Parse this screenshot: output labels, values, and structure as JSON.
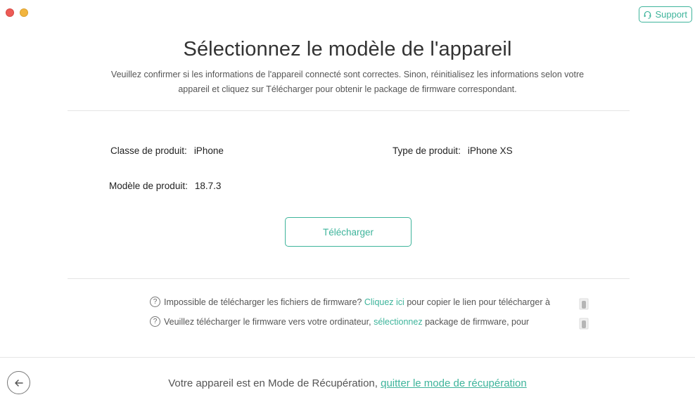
{
  "window": {
    "controls": [
      "close",
      "minimize"
    ]
  },
  "support": {
    "label": "Support",
    "icon": "headset-icon"
  },
  "header": {
    "title": "Sélectionnez le modèle de l'appareil",
    "subtitle_line1": "Veuillez confirmer si les informations de l'appareil connecté sont correctes. Sinon, réinitialisez les informations selon votre",
    "subtitle_line2": "appareil et cliquez sur Télécharger pour obtenir le package de firmware correspondant."
  },
  "device_info": {
    "product_class_label": "Classe de produit:",
    "product_class_value": "iPhone",
    "product_type_label": "Type de produit:",
    "product_type_value": "iPhone XS",
    "product_model_label": "Modèle de produit:",
    "product_model_value": "18.7.3"
  },
  "download": {
    "label": "Télécharger"
  },
  "help": {
    "line1_pre": "Impossible de télécharger les fichiers de firmware?",
    "line1_link": "Cliquez ici",
    "line1_post": "pour copier le lien pour télécharger à",
    "line2_pre": "Veuillez télécharger le firmware vers votre ordinateur,",
    "line2_link": "sélectionnez",
    "line2_post": "package de firmware, pour"
  },
  "footer": {
    "text": "Votre appareil est en Mode de Récupération,",
    "link": "quitter le mode de récupération"
  },
  "colors": {
    "accent": "#3eb49b",
    "close": "#ed5b56",
    "minimize": "#f2b53f"
  }
}
